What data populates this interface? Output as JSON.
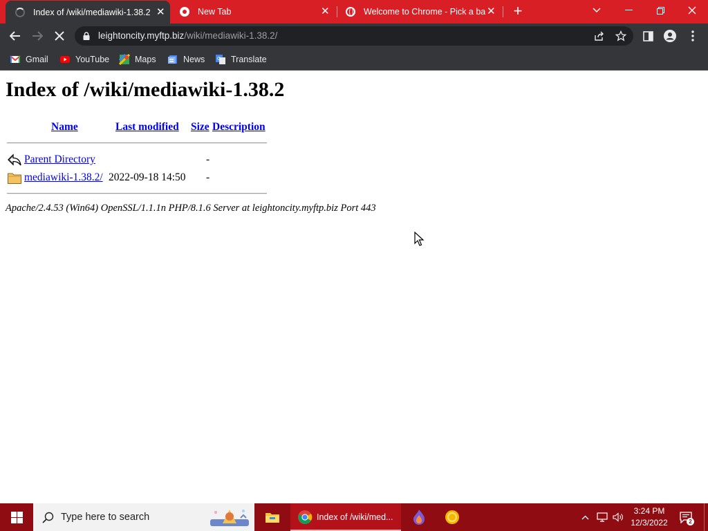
{
  "browser": {
    "tabs": [
      {
        "title": "Index of /wiki/mediawiki-1.38.2",
        "active": true,
        "icon": "loading-spinner"
      },
      {
        "title": "New Tab",
        "active": false,
        "icon": "chrome-icon"
      },
      {
        "title": "Welcome to Chrome - Pick a bac",
        "active": false,
        "icon": "globe-icon"
      }
    ],
    "url_host": "leightoncity.myftp.biz",
    "url_path": "/wiki/mediawiki-1.38.2/",
    "bookmarks": [
      {
        "label": "Gmail",
        "icon": "gmail-icon"
      },
      {
        "label": "YouTube",
        "icon": "youtube-icon"
      },
      {
        "label": "Maps",
        "icon": "maps-icon"
      },
      {
        "label": "News",
        "icon": "news-icon"
      },
      {
        "label": "Translate",
        "icon": "translate-icon"
      }
    ],
    "theme_color": "#d81f26"
  },
  "page": {
    "heading": "Index of /wiki/mediawiki-1.38.2",
    "columns": {
      "name": "Name",
      "modified": "Last modified",
      "size": "Size",
      "description": "Description"
    },
    "rows": [
      {
        "name": "Parent Directory",
        "modified": "",
        "size": "-",
        "description": "",
        "icon": "back-arrow-icon"
      },
      {
        "name": "mediawiki-1.38.2/",
        "modified": "2022-09-18 14:50",
        "size": "-",
        "description": "",
        "icon": "folder-icon"
      }
    ],
    "server_signature": "Apache/2.4.53 (Win64) OpenSSL/1.1.1n PHP/8.1.6 Server at leightoncity.myftp.biz Port 443"
  },
  "taskbar": {
    "search_placeholder": "Type here to search",
    "chrome_task_label": "Index of /wiki/med...",
    "time": "3:24 PM",
    "date": "12/3/2022",
    "color": "#8f0d12"
  }
}
